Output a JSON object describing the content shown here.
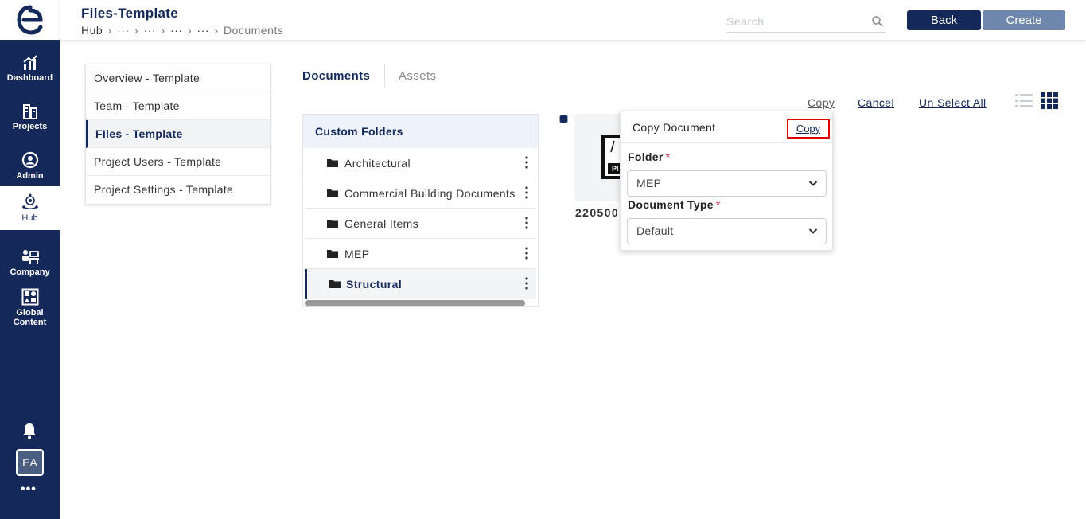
{
  "header": {
    "title": "Files-Template",
    "breadcrumb": [
      "Hub",
      "···",
      "···",
      "···",
      "···",
      "Documents"
    ],
    "search_placeholder": "Search",
    "back_label": "Back",
    "create_label": "Create"
  },
  "sidebar": {
    "items": [
      {
        "label": "Dashboard",
        "icon": "dashboard-icon"
      },
      {
        "label": "Projects",
        "icon": "projects-icon"
      },
      {
        "label": "Admin",
        "icon": "admin-icon"
      },
      {
        "label": "Hub",
        "icon": "hub-icon",
        "active": true
      },
      {
        "label": "Company",
        "icon": "company-icon"
      },
      {
        "label": "Global Content",
        "icon": "global-content-icon"
      }
    ],
    "avatar_initials": "EA",
    "more_label": "•••"
  },
  "settings_menu": [
    {
      "label": "Overview - Template"
    },
    {
      "label": "Team - Template"
    },
    {
      "label": "FIles - Template",
      "active": true
    },
    {
      "label": "Project Users - Template"
    },
    {
      "label": "Project Settings - Template"
    }
  ],
  "tabs": [
    {
      "label": "Documents",
      "active": true
    },
    {
      "label": "Assets"
    }
  ],
  "actions": {
    "copy": "Copy",
    "cancel": "Cancel",
    "unselect_all": "Un Select All"
  },
  "folders": {
    "header": "Custom Folders",
    "items": [
      {
        "name": "Architectural"
      },
      {
        "name": "Commercial Building Documents"
      },
      {
        "name": "General Items"
      },
      {
        "name": "MEP"
      },
      {
        "name": "Structural",
        "active": true
      }
    ]
  },
  "document": {
    "name": "220500",
    "thumb_label": "PI"
  },
  "copy_popup": {
    "title": "Copy Document",
    "copy_label": "Copy",
    "folder_label": "Folder",
    "folder_value": "MEP",
    "doctype_label": "Document Type",
    "doctype_value": "Default",
    "required_mark": "*"
  },
  "colors": {
    "brand": "#14295a",
    "accent_light": "#6f87ad",
    "highlight": "#e00000"
  }
}
